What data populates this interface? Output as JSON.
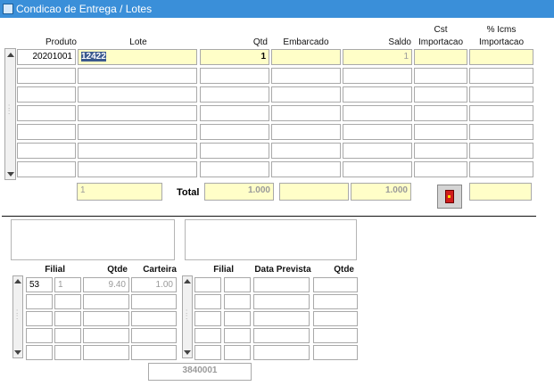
{
  "window": {
    "title": "Condicao de Entrega / Lotes"
  },
  "lots": {
    "headers": {
      "produto": "Produto",
      "lote": "Lote",
      "qtd": "Qtd",
      "embarcado": "Embarcado",
      "saldo": "Saldo",
      "cst_line1": "Cst",
      "cst_line2": "Importacao",
      "icms_line1": "% Icms",
      "icms_line2": "Importacao"
    },
    "rows": [
      {
        "produto": "20201001",
        "lote": "12422",
        "qtd": "1",
        "embarcado": "",
        "saldo": "1",
        "cst": "",
        "icms": ""
      },
      {
        "produto": "",
        "lote": "",
        "qtd": "",
        "embarcado": "",
        "saldo": "",
        "cst": "",
        "icms": ""
      },
      {
        "produto": "",
        "lote": "",
        "qtd": "",
        "embarcado": "",
        "saldo": "",
        "cst": "",
        "icms": ""
      },
      {
        "produto": "",
        "lote": "",
        "qtd": "",
        "embarcado": "",
        "saldo": "",
        "cst": "",
        "icms": ""
      },
      {
        "produto": "",
        "lote": "",
        "qtd": "",
        "embarcado": "",
        "saldo": "",
        "cst": "",
        "icms": ""
      },
      {
        "produto": "",
        "lote": "",
        "qtd": "",
        "embarcado": "",
        "saldo": "",
        "cst": "",
        "icms": ""
      },
      {
        "produto": "",
        "lote": "",
        "qtd": "",
        "embarcado": "",
        "saldo": "",
        "cst": "",
        "icms": ""
      }
    ],
    "footer": {
      "count": "1",
      "total_label": "Total",
      "total_qtd": "1.000",
      "total_embarcado": "",
      "total_saldo": "1.000",
      "icms_total": ""
    }
  },
  "filial": {
    "headers": {
      "filial": "Filial",
      "qtde": "Qtde",
      "carteira": "Carteira"
    },
    "rows": [
      {
        "filial": "53",
        "col2": "1",
        "qtde": "9.40",
        "carteira": "1.00"
      },
      {
        "filial": "",
        "col2": "",
        "qtde": "",
        "carteira": ""
      },
      {
        "filial": "",
        "col2": "",
        "qtde": "",
        "carteira": ""
      },
      {
        "filial": "",
        "col2": "",
        "qtde": "",
        "carteira": ""
      },
      {
        "filial": "",
        "col2": "",
        "qtde": "",
        "carteira": ""
      }
    ]
  },
  "prevista": {
    "headers": {
      "filial": "Filial",
      "data_prevista": "Data Prevista",
      "qtde": "Qtde"
    },
    "rows": [
      {
        "filial": "",
        "col2": "",
        "data": "",
        "qtde": ""
      },
      {
        "filial": "",
        "col2": "",
        "data": "",
        "qtde": ""
      },
      {
        "filial": "",
        "col2": "",
        "data": "",
        "qtde": ""
      },
      {
        "filial": "",
        "col2": "",
        "data": "",
        "qtde": ""
      },
      {
        "filial": "",
        "col2": "",
        "data": "",
        "qtde": ""
      }
    ]
  },
  "bottom": {
    "code": "3840001"
  },
  "colors": {
    "titlebar": "#3a8fd9",
    "field_yellow": "#fffec8",
    "selection": "#3c5a8e"
  },
  "icons": {
    "exit_button": "exit-door-icon"
  }
}
